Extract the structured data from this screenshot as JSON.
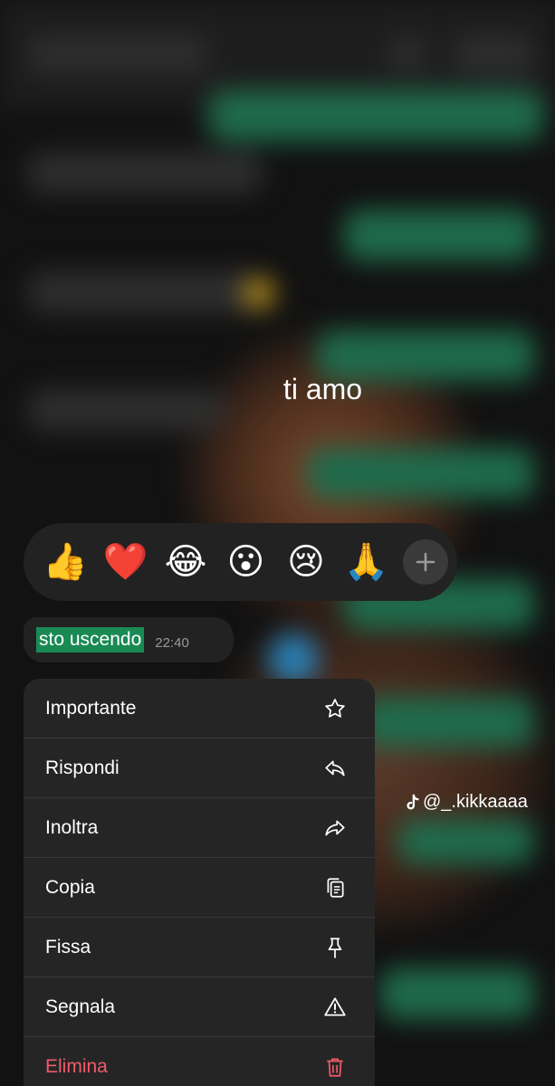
{
  "caption": "ti amo",
  "reactions": {
    "emojis": [
      "👍",
      "❤️",
      "😂",
      "😮",
      "😢",
      "🙏"
    ],
    "more_icon": "plus-icon"
  },
  "message": {
    "text": "sto uscendo",
    "time": "22:40",
    "highlight_color": "#1a8a55"
  },
  "menu": {
    "items": [
      {
        "label": "Importante",
        "icon": "star-icon"
      },
      {
        "label": "Rispondi",
        "icon": "reply-icon"
      },
      {
        "label": "Inoltra",
        "icon": "forward-icon"
      },
      {
        "label": "Copia",
        "icon": "copy-icon"
      },
      {
        "label": "Fissa",
        "icon": "pin-icon"
      },
      {
        "label": "Segnala",
        "icon": "warning-icon"
      },
      {
        "label": "Elimina",
        "icon": "trash-icon"
      }
    ],
    "danger_color": "#ef5b6a"
  },
  "watermark": {
    "text": "@_.kikkaaaa",
    "icon": "tiktok-icon"
  }
}
